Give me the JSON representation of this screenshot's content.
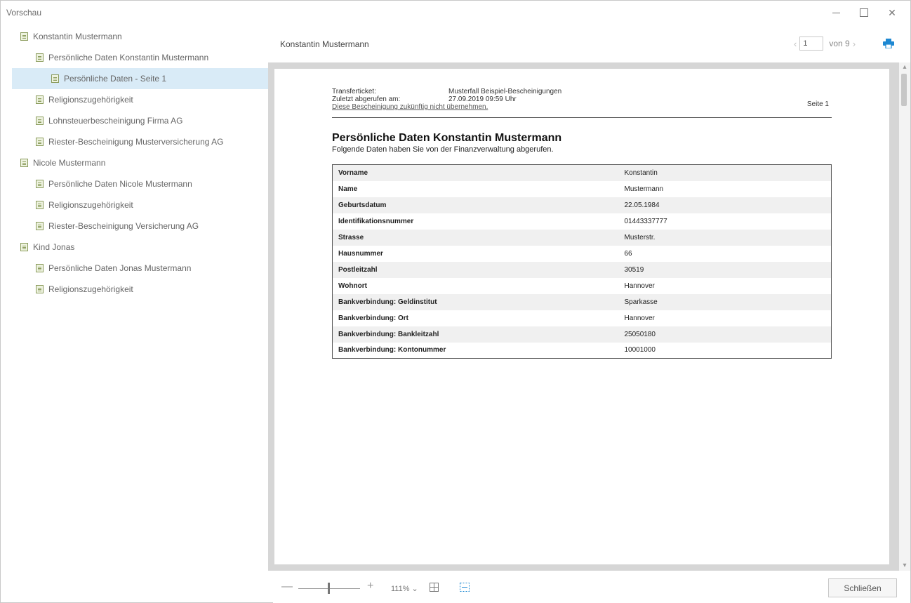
{
  "window": {
    "title": "Vorschau",
    "controls": {
      "minimize": "—",
      "maximize": "",
      "close": "✕"
    }
  },
  "sidebar": {
    "items": [
      {
        "label": "Konstantin Mustermann",
        "level": 0,
        "selected": false
      },
      {
        "label": "Persönliche Daten Konstantin Mustermann",
        "level": 1,
        "selected": false
      },
      {
        "label": "Persönliche Daten - Seite 1",
        "level": 2,
        "selected": true
      },
      {
        "label": "Religionszugehörigkeit",
        "level": 1,
        "selected": false
      },
      {
        "label": "Lohnsteuerbescheinigung Firma AG",
        "level": 1,
        "selected": false
      },
      {
        "label": "Riester-Bescheinigung Musterversicherung AG",
        "level": 1,
        "selected": false
      },
      {
        "label": "Nicole Mustermann",
        "level": 0,
        "selected": false
      },
      {
        "label": "Persönliche Daten Nicole Mustermann",
        "level": 1,
        "selected": false
      },
      {
        "label": "Religionszugehörigkeit",
        "level": 1,
        "selected": false
      },
      {
        "label": "Riester-Bescheinigung Versicherung AG",
        "level": 1,
        "selected": false
      },
      {
        "label": "Kind Jonas",
        "level": 0,
        "selected": false
      },
      {
        "label": "Persönliche Daten Jonas Mustermann",
        "level": 1,
        "selected": false
      },
      {
        "label": "Religionszugehörigkeit",
        "level": 1,
        "selected": false
      }
    ]
  },
  "header": {
    "doc_title": "Konstantin Mustermann",
    "page_input": "1",
    "page_total_label": "von 9",
    "prev": "‹",
    "next": "›"
  },
  "document": {
    "transfer_label": "Transferticket:",
    "transfer_value": "Musterfall Beispiel-Bescheinigungen",
    "retrieved_label": "Zuletzt abgerufen am:",
    "retrieved_value": "27.09.2019 09:59 Uhr",
    "ignore_link": "Diese Bescheinigung zukünftig nicht übernehmen.",
    "page_label": "Seite 1",
    "title": "Persönliche Daten Konstantin Mustermann",
    "subtitle": "Folgende Daten haben Sie von der Finanzverwaltung abgerufen.",
    "rows": [
      {
        "key": "Vorname",
        "value": "Konstantin"
      },
      {
        "key": "Name",
        "value": "Mustermann"
      },
      {
        "key": "Geburtsdatum",
        "value": "22.05.1984"
      },
      {
        "key": "Identifikationsnummer",
        "value": "01443337777"
      },
      {
        "key": "Strasse",
        "value": "Musterstr."
      },
      {
        "key": "Hausnummer",
        "value": "66"
      },
      {
        "key": "Postleitzahl",
        "value": "30519"
      },
      {
        "key": "Wohnort",
        "value": "Hannover"
      },
      {
        "key": "Bankverbindung: Geldinstitut",
        "value": "Sparkasse"
      },
      {
        "key": "Bankverbindung: Ort",
        "value": "Hannover"
      },
      {
        "key": "Bankverbindung: Bankleitzahl",
        "value": "25050180"
      },
      {
        "key": "Bankverbindung: Kontonummer",
        "value": "10001000"
      }
    ]
  },
  "bottombar": {
    "zoom_minus": "—",
    "zoom_plus": "+",
    "zoom_level": "111% ⌄",
    "close_label": "Schließen"
  },
  "colors": {
    "selection": "#d9ebf7",
    "print_icon": "#1e88d2",
    "viewer_bg": "#d6d6d6"
  }
}
